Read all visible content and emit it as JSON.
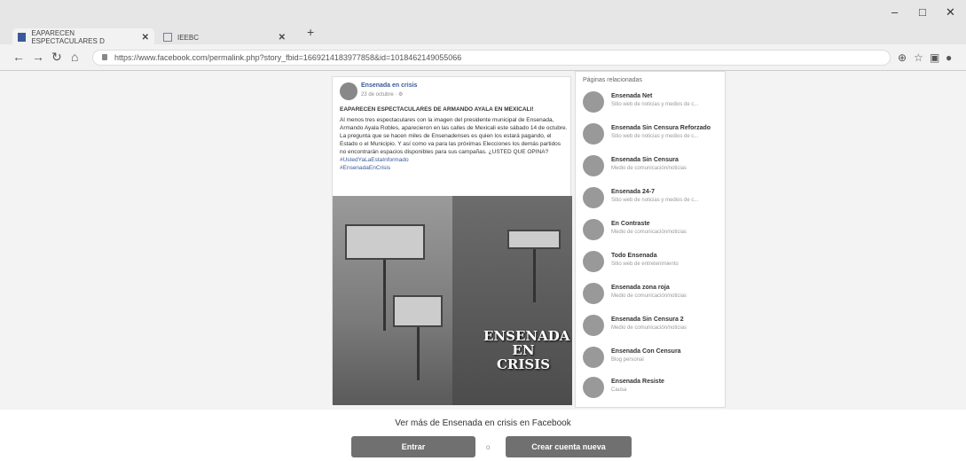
{
  "browser": {
    "active_tab_title": "EAPARECEN ESPECTACULARES D",
    "active_tab_close": "✕",
    "other_tab_title": "IEEBC",
    "other_tab_close": "✕",
    "new_tab": "+",
    "url": "https://www.facebook.com/permalink.php?story_fbid=1669214183977858&id=1018462149055066",
    "window_controls": {
      "minimize": "–",
      "maximize": "□",
      "close": "✕"
    }
  },
  "post": {
    "page_name": "Ensenada en crisis",
    "date": "23 de octubre · ⚙",
    "headline": "EAPARECEN ESPECTACULARES DE ARMANDO AYALA EN MEXICALI!",
    "body": "Al menos tres espectaculares con la imagen del presidente municipal de Ensenada, Armando Ayala Robles, aparecieron en las calles de Mexicali este sábado 14 de octubre. La pregunta que se hacen miles de Ensenadenses es quien los estará pagando, el Estado o el Municipio. Y así como va para las próximas Elecciones los demás partidos no encontrarán espacios disponibles para sus campañas. ¿USTED QUE OPINA?",
    "tags": [
      "#UstedYaLaEstaInformado",
      "#EnsenadaEnCrisis"
    ],
    "image_text": "ENSENADA EN CRISIS"
  },
  "related": {
    "header": "Páginas relacionadas",
    "items": [
      {
        "name": "Ensenada Net",
        "desc": "Sitio web de noticias y medios de c..."
      },
      {
        "name": "Ensenada Sin Censura Reforzado",
        "desc": "Sitio web de noticias y medios de c..."
      },
      {
        "name": "Ensenada Sin Censura",
        "desc": "Medio de comunicación/noticias"
      },
      {
        "name": "Ensenada 24-7",
        "desc": "Sitio web de noticias y medios de c..."
      },
      {
        "name": "En Contraste",
        "desc": "Medio de comunicación/noticias"
      },
      {
        "name": "Todo Ensenada",
        "desc": "Sitio web de entretenimiento"
      },
      {
        "name": "Ensenada zona roja",
        "desc": "Medio de comunicación/noticias"
      },
      {
        "name": "Ensenada Sin Censura 2",
        "desc": "Medio de comunicación/noticias"
      },
      {
        "name": "Ensenada Con Censura",
        "desc": "Blog personal"
      },
      {
        "name": "Ensenada Resiste",
        "desc": "Causa"
      }
    ]
  },
  "footer": {
    "see_more": "Ver más de Ensenada en crisis en Facebook",
    "login_button": "Entrar",
    "or": "o",
    "create_button": "Crear cuenta nueva"
  }
}
